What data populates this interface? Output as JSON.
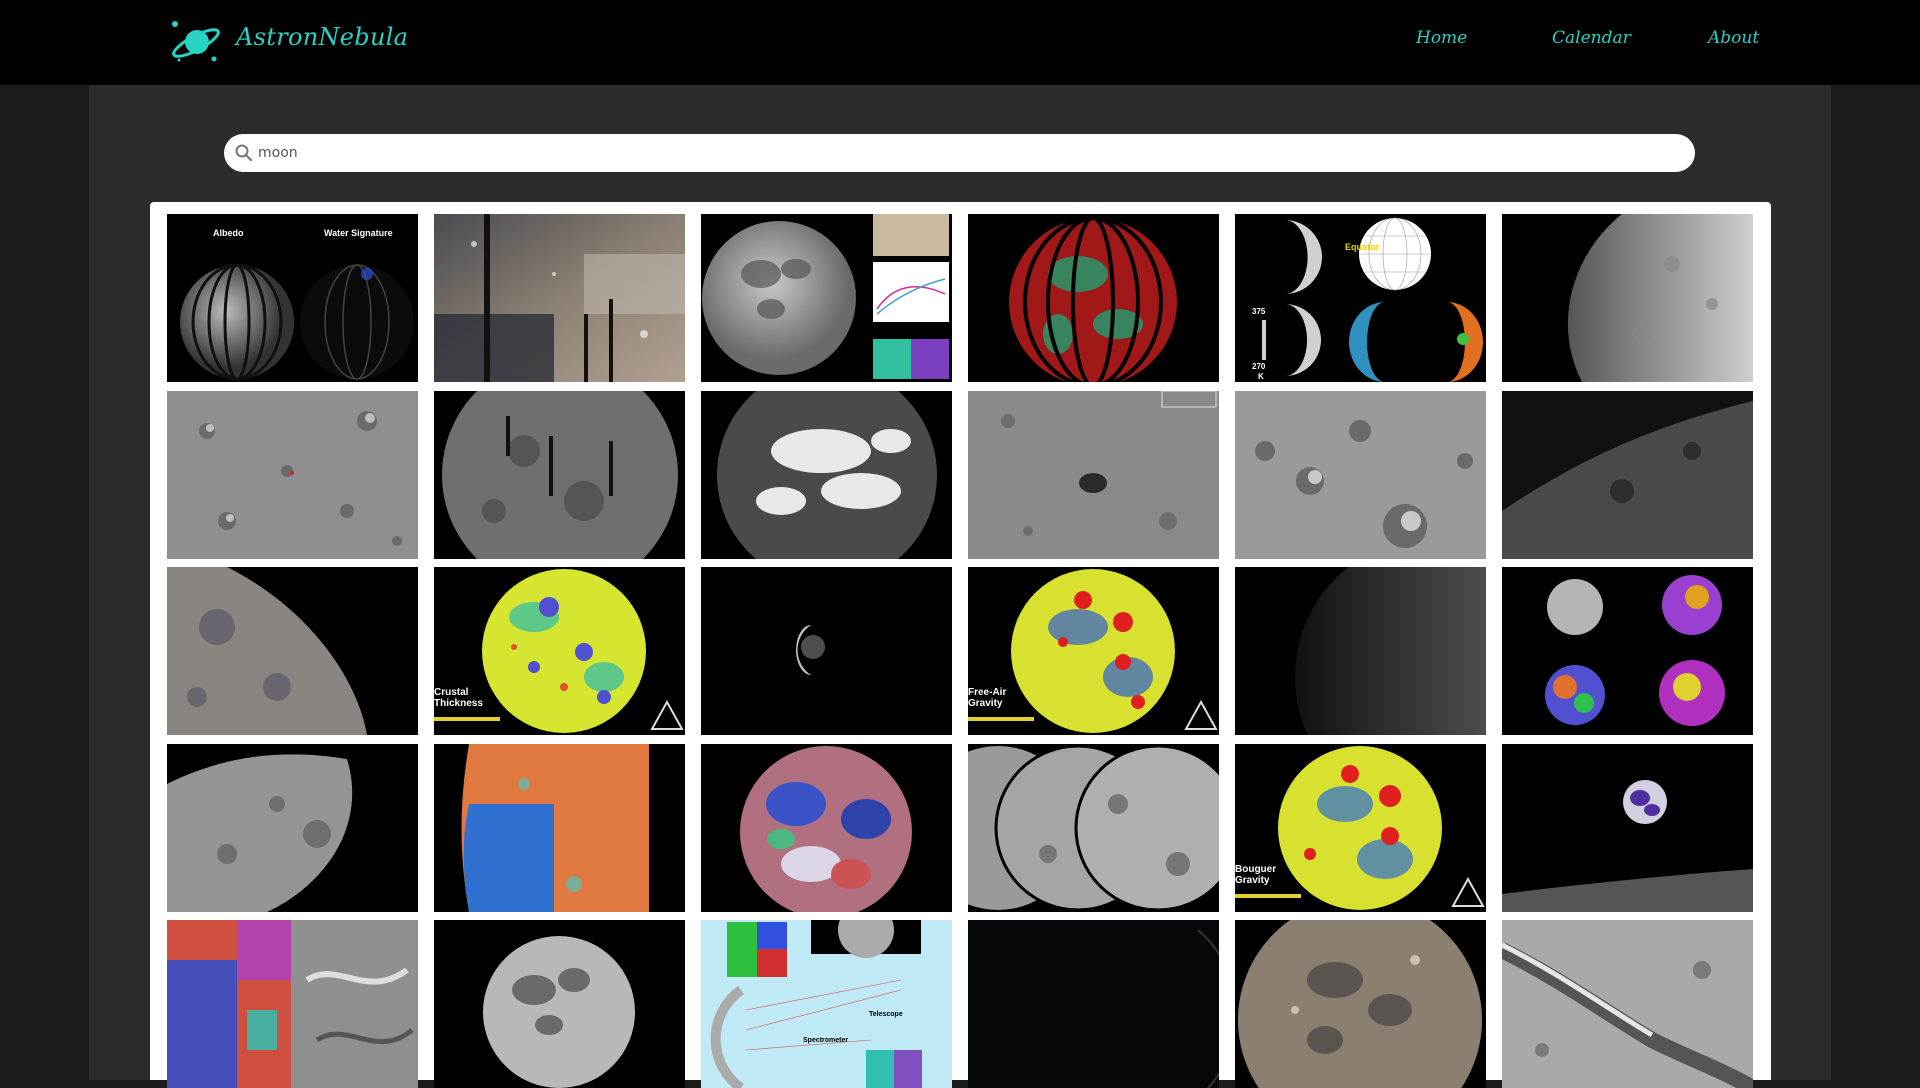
{
  "app": {
    "brand": "AstronNebula",
    "logo_icon": "planet-icon"
  },
  "nav": {
    "home": "Home",
    "calendar": "Calendar",
    "about": "About"
  },
  "search": {
    "value": "moon",
    "icon": "search-icon"
  },
  "colors": {
    "accent": "#27d3c3",
    "topbar": "#000000",
    "panel": "#2c2c2c",
    "page_bg": "#1c1c1c"
  },
  "gallery": {
    "labels": {
      "albedo": "Albedo",
      "water_signature": "Water Signature",
      "equator": "Equator",
      "temp_high": "375",
      "temp_low": "270",
      "temp_unit": "K",
      "crustal": "Crustal\nThickness",
      "free_air": "Free-Air\nGravity",
      "bouguer": "Bouguer\nGravity",
      "telescope": "Telescope",
      "spectrometer": "Spectrometer"
    }
  }
}
